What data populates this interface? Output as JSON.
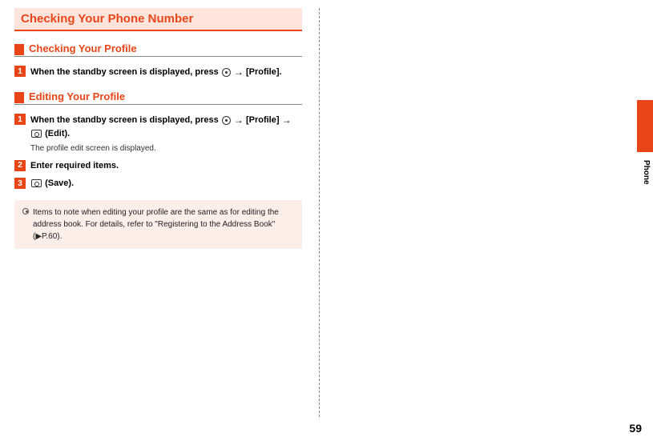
{
  "titleBar": {
    "text": "Checking Your Phone Number"
  },
  "section1": {
    "heading": "Checking Your Profile",
    "step1": {
      "num": "1",
      "pre": "When the standby screen is displayed, press ",
      "post": "[Profile]."
    }
  },
  "section2": {
    "heading": "Editing Your Profile",
    "step1": {
      "num": "1",
      "pre": "When the standby screen is displayed, press ",
      "mid": "[Profile] ",
      "end": " (Edit).",
      "desc": "The profile edit screen is displayed."
    },
    "step2": {
      "num": "2",
      "title": "Enter required items."
    },
    "step3": {
      "num": "3",
      "end": " (Save)."
    }
  },
  "note": {
    "text": "Items to note when editing your profile are the same as for editing the address book. For details, refer to \"Registering to the Address Book\" (▶P.60)."
  },
  "sideLabel": "Phone",
  "pageNumber": "59"
}
